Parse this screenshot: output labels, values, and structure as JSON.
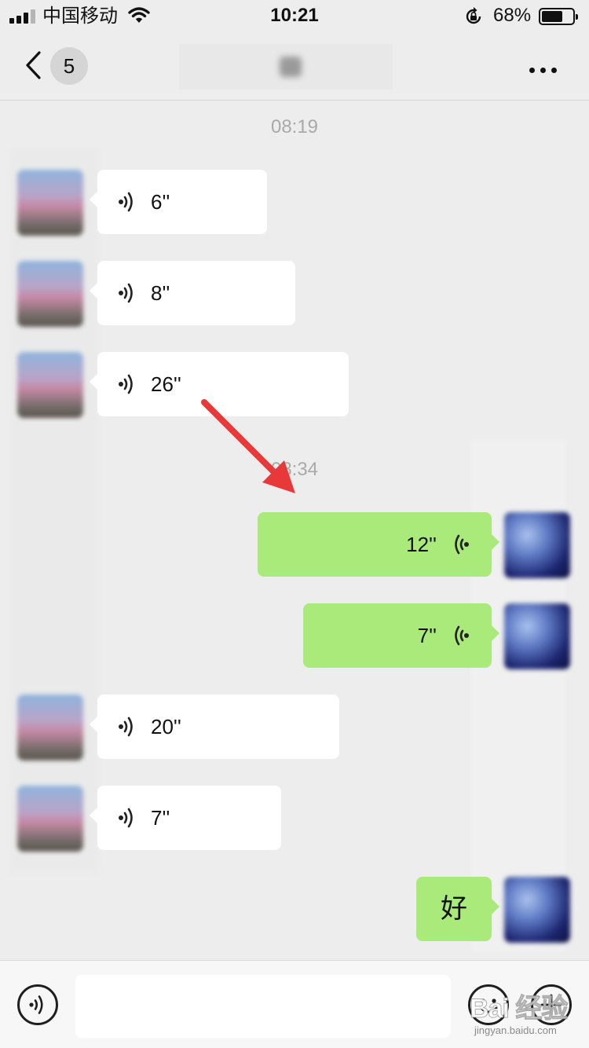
{
  "status_bar": {
    "carrier": "中国移动",
    "time": "10:21",
    "battery_percent": "68%",
    "battery_level": 0.68,
    "signal_bars_filled": 3,
    "icons": [
      "signal-icon",
      "wifi-icon",
      "rotation-lock-icon",
      "battery-icon"
    ]
  },
  "nav": {
    "back_icon": "chevron-left-icon",
    "unread_count": "5",
    "more_icon": "more-dots-icon"
  },
  "chat": {
    "timestamps": [
      "08:19",
      "08:34"
    ],
    "messages": [
      {
        "from": "peer",
        "type": "voice",
        "duration": "6''"
      },
      {
        "from": "peer",
        "type": "voice",
        "duration": "8''"
      },
      {
        "from": "peer",
        "type": "voice",
        "duration": "26''"
      },
      {
        "from": "self",
        "type": "voice",
        "duration": "12''"
      },
      {
        "from": "self",
        "type": "voice",
        "duration": "7''"
      },
      {
        "from": "peer",
        "type": "voice",
        "duration": "20''"
      },
      {
        "from": "peer",
        "type": "voice",
        "duration": "7''"
      },
      {
        "from": "self",
        "type": "text",
        "text": "好"
      }
    ]
  },
  "input_bar": {
    "voice_icon": "voice-mode-icon",
    "emoji_icon": "emoji-icon",
    "plus_icon": "plus-icon",
    "input_value": ""
  },
  "watermark": {
    "text": "Bai 经验",
    "url": "jingyan.baidu.com"
  },
  "colors": {
    "background": "#ededed",
    "outgoing_bubble": "#a9ea7a",
    "incoming_bubble": "#ffffff",
    "annotation_arrow": "#e8393a"
  }
}
